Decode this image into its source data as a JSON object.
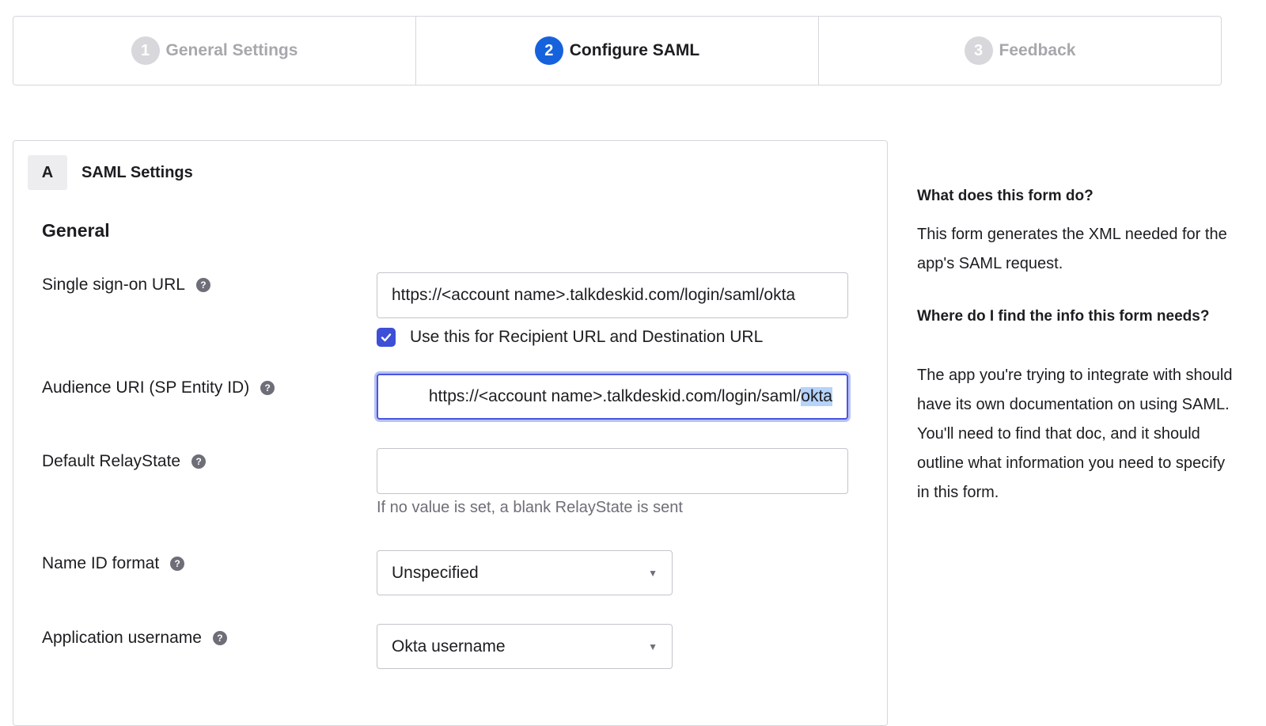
{
  "steps": [
    {
      "number": "1",
      "label": "General Settings",
      "state": "inactive"
    },
    {
      "number": "2",
      "label": "Configure SAML",
      "state": "active"
    },
    {
      "number": "3",
      "label": "Feedback",
      "state": "inactive"
    }
  ],
  "section": {
    "letter": "A",
    "title": "SAML Settings"
  },
  "group_title": "General",
  "fields": {
    "sso_url": {
      "label": "Single sign-on URL",
      "value": "https://<account name>.talkdeskid.com/login/saml/okta"
    },
    "recipient_checkbox": {
      "label": "Use this for Recipient URL and Destination URL",
      "checked": true
    },
    "audience_uri": {
      "label": "Audience URI (SP Entity ID)",
      "value_prefix": "https://<account name>.talkdeskid.com/login/saml/",
      "value_selected": "okta"
    },
    "relay_state": {
      "label": "Default RelayState",
      "value": "",
      "hint": "If no value is set, a blank RelayState is sent"
    },
    "name_id_format": {
      "label": "Name ID format",
      "selected": "Unspecified"
    },
    "app_username": {
      "label": "Application username",
      "selected": "Okta username"
    }
  },
  "help_glyph": "?",
  "aside": {
    "q1": "What does this form do?",
    "a1": "This form generates the XML needed for the app's SAML request.",
    "q2": "Where do I find the info this form needs?",
    "a2": "The app you're trying to integrate with should have its own documentation on using SAML. You'll need to find that doc, and it should outline what information you need to specify in this form."
  },
  "colors": {
    "accent": "#1662dd",
    "checkbox": "#3d4fd6",
    "focus_ring": "#4a56e2"
  }
}
